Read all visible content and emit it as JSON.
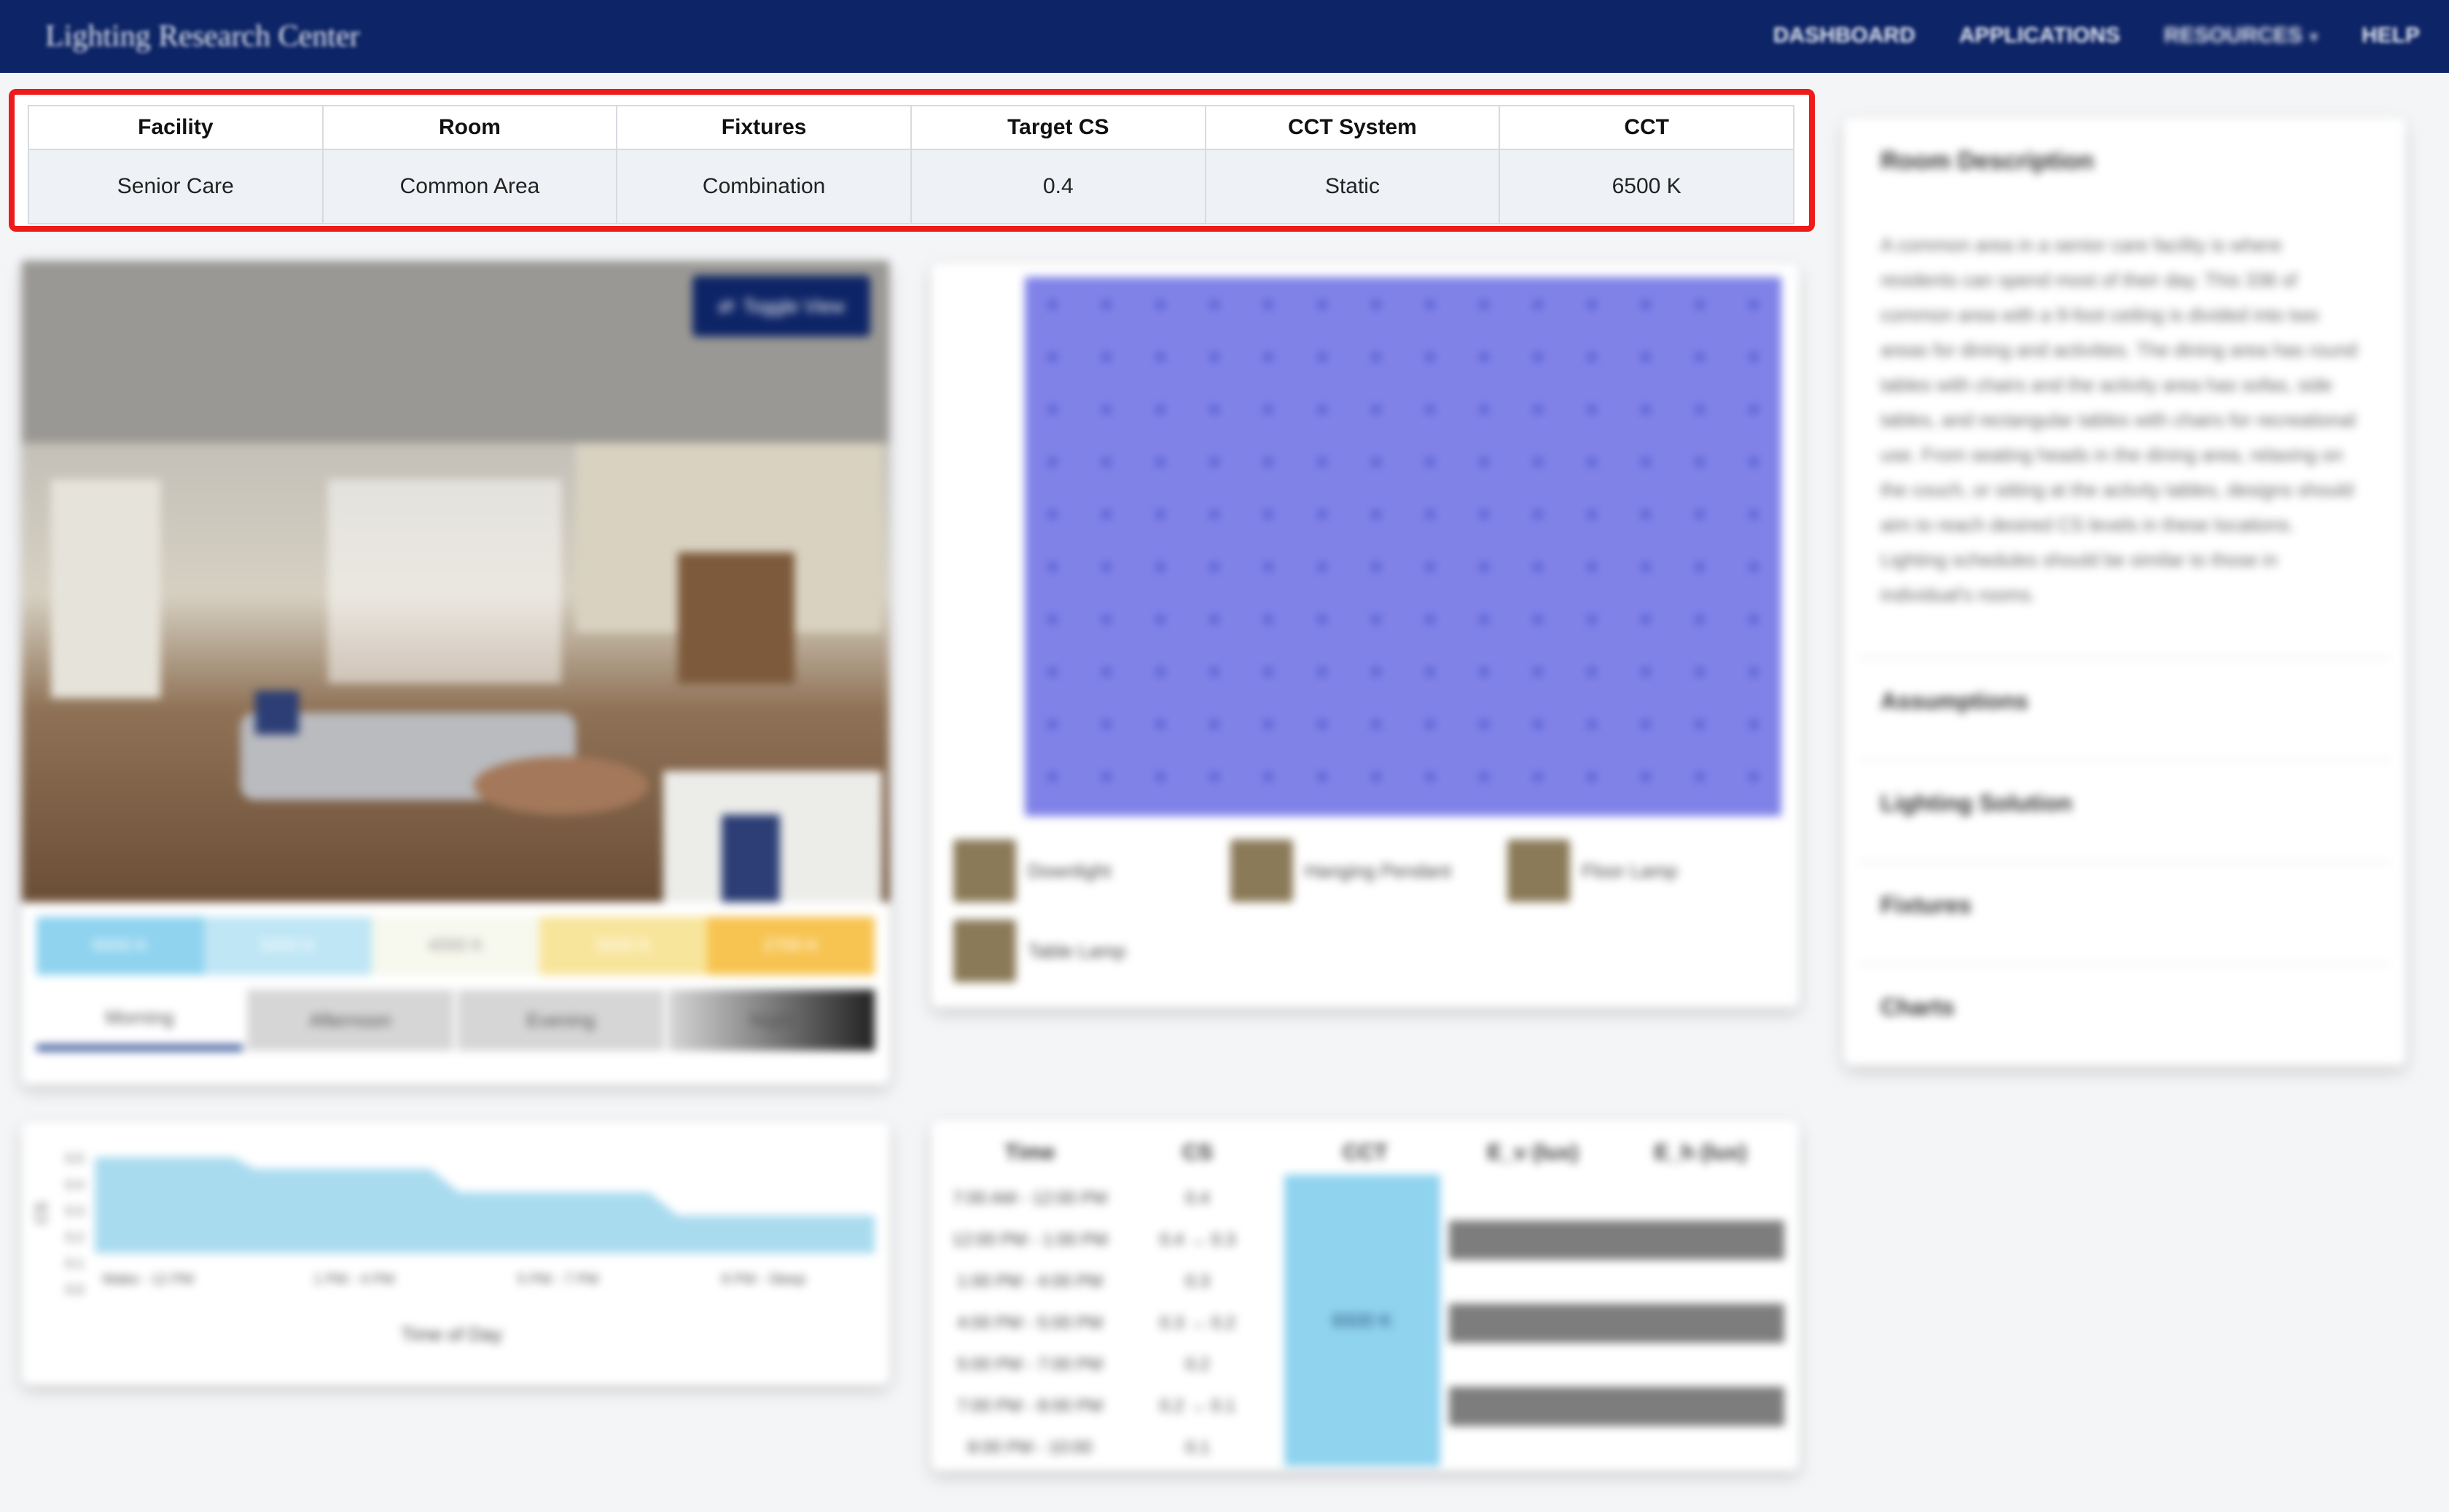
{
  "header": {
    "brand": "Lighting Research Center",
    "nav": [
      "DASHBOARD",
      "APPLICATIONS",
      "RESOURCES",
      "HELP"
    ]
  },
  "summary": {
    "columns": [
      "Facility",
      "Room",
      "Fixtures",
      "Target CS",
      "CCT System",
      "CCT"
    ],
    "values": [
      "Senior Care",
      "Common Area",
      "Combination",
      "0.4",
      "Static",
      "6500 K"
    ]
  },
  "viewer": {
    "toggle_label": "Toggle View",
    "cct_options": [
      "6500 K",
      "5000 K",
      "4000 K",
      "3000 K",
      "2700 K"
    ],
    "cct_colors": [
      "#8fd3ef",
      "#bfe6f5",
      "#f7f8ee",
      "#f8e59c",
      "#f7c451"
    ],
    "time_tabs": [
      "Morning",
      "Afternoon",
      "Evening",
      "Night"
    ]
  },
  "cs_chart": {
    "ylabel": "CS",
    "xlabel": "Time of Day",
    "yticks": [
      "0.5",
      "0.4",
      "0.3",
      "0.2",
      "0.1",
      "0.0"
    ],
    "xticks": [
      "Wake - 12 PM",
      "1 PM - 4 PM",
      "5 PM - 7 PM",
      "8 PM - Sleep"
    ]
  },
  "plan_legend": [
    "Downlight",
    "Hanging Pendant",
    "Floor Lamp",
    "Table Lamp"
  ],
  "schedule": {
    "headers": [
      "Time",
      "CS",
      "CCT",
      "E_v (lux)",
      "E_h (lux)"
    ],
    "rows": [
      [
        "7:00 AM - 12:00 PM",
        "0.4"
      ],
      [
        "12:00 PM - 1:00 PM",
        "0.4 → 0.3"
      ],
      [
        "1:00 PM - 4:00 PM",
        "0.3"
      ],
      [
        "4:00 PM - 5:00 PM",
        "0.3 → 0.2"
      ],
      [
        "5:00 PM - 7:00 PM",
        "0.2"
      ],
      [
        "7:00 PM - 8:00 PM",
        "0.2 → 0.1"
      ],
      [
        "8:00 PM - 10:00",
        "0.1"
      ]
    ],
    "cct_value": "6500 K"
  },
  "sidebar": {
    "title": "Room Description",
    "text": "A common area in a senior care facility is where residents can spend most of their day. This 336 sf common area with a 9-foot ceiling is divided into two areas for dining and activities. The dining area has round tables with chairs and the activity area has sofas, side tables, and rectangular tables with chairs for recreational use. From seating heads in the dining area, relaxing on the couch, or sitting at the activity tables, designs should aim to reach desired CS levels in these locations. Lighting schedules should be similar to those in individual's rooms.",
    "sections": [
      "Assumptions",
      "Lighting Solution",
      "Fixtures",
      "Charts"
    ]
  }
}
